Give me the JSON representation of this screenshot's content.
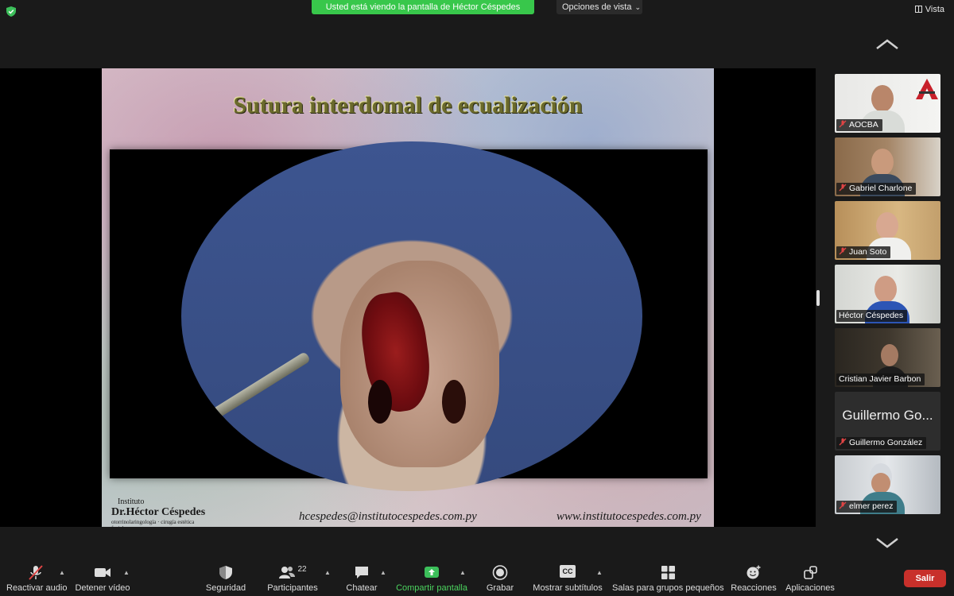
{
  "topbar": {
    "share_banner": "Usted está viendo la pantalla de Héctor Céspedes",
    "view_options": "Opciones de vista",
    "vista": "Vista"
  },
  "slide": {
    "title": "Sutura interdomal de ecualización",
    "logo_line1": "Instituto",
    "logo_line2": "Dr.Héctor Céspedes",
    "logo_line3": "otorrinolaringología · cirugía estética facial",
    "email": "hcespedes@institutocespedes.com.py",
    "website": "www.institutocespedes.com.py"
  },
  "participants": [
    {
      "name": "AOCBA",
      "muted": true
    },
    {
      "name": "Gabriel Charlone",
      "muted": true
    },
    {
      "name": "Juan Soto",
      "muted": true
    },
    {
      "name": "Héctor Céspedes",
      "muted": false,
      "active": true
    },
    {
      "name": "Cristian Javier Barbon",
      "muted": false
    },
    {
      "name": "Guillermo González",
      "muted": true,
      "placeholder": "Guillermo Go..."
    },
    {
      "name": "elmer perez",
      "muted": true
    }
  ],
  "toolbar": {
    "unmute": "Reactivar audio",
    "stop_video": "Detener vídeo",
    "security": "Seguridad",
    "participants": "Participantes",
    "participants_count": "22",
    "chat": "Chatear",
    "share_screen": "Compartir pantalla",
    "record": "Grabar",
    "subtitles": "Mostrar subtítulos",
    "subtitles_badge": "CC",
    "breakout": "Salas para grupos pequeños",
    "reactions": "Reacciones",
    "apps": "Aplicaciones",
    "leave": "Salir"
  },
  "colors": {
    "share_banner": "#38c74b",
    "leave_button": "#c8302b",
    "active_speaker": "#2fa745"
  }
}
